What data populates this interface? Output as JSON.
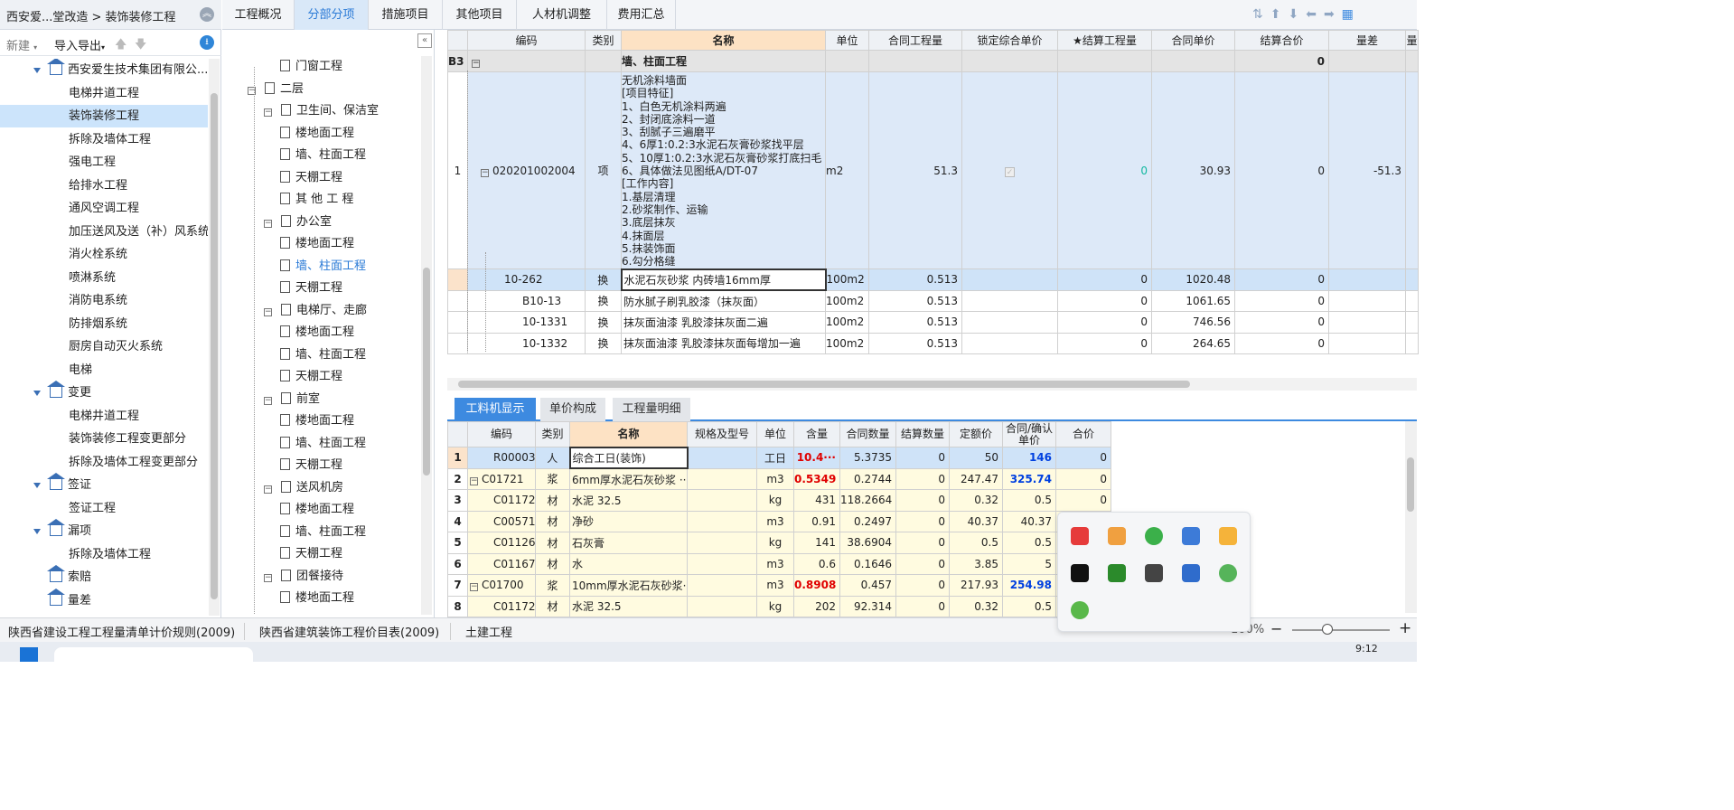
{
  "breadcrumb": "西安爱...堂改造 > 装饰装修工程",
  "left_toolbar": {
    "new": "新建",
    "import_export": "导入导出"
  },
  "left_tree": [
    {
      "label": "西安爱生技术集团有限公...",
      "type": "house",
      "expanded": true,
      "level": 1
    },
    {
      "label": "电梯井道工程",
      "level": 2
    },
    {
      "label": "装饰装修工程",
      "level": 2,
      "selected": true
    },
    {
      "label": "拆除及墙体工程",
      "level": 2
    },
    {
      "label": "强电工程",
      "level": 2
    },
    {
      "label": "给排水工程",
      "level": 2
    },
    {
      "label": "通风空调工程",
      "level": 2
    },
    {
      "label": "加压送风及送（补）风系统",
      "level": 2
    },
    {
      "label": "消火栓系统",
      "level": 2
    },
    {
      "label": "喷淋系统",
      "level": 2
    },
    {
      "label": "消防电系统",
      "level": 2
    },
    {
      "label": "防排烟系统",
      "level": 2
    },
    {
      "label": "厨房自动灭火系统",
      "level": 2
    },
    {
      "label": "电梯",
      "level": 2
    },
    {
      "label": "变更",
      "type": "house",
      "expanded": true,
      "level": 1
    },
    {
      "label": "电梯井道工程",
      "level": 2
    },
    {
      "label": "装饰装修工程变更部分",
      "level": 2
    },
    {
      "label": "拆除及墙体工程变更部分",
      "level": 2
    },
    {
      "label": "签证",
      "type": "house",
      "expanded": true,
      "level": 1
    },
    {
      "label": "签证工程",
      "level": 2
    },
    {
      "label": "漏项",
      "type": "house",
      "expanded": true,
      "level": 1
    },
    {
      "label": "拆除及墙体工程",
      "level": 2
    },
    {
      "label": "索赔",
      "type": "house",
      "level": 1
    },
    {
      "label": "量差",
      "type": "house",
      "level": 1
    }
  ],
  "mid_tree": [
    {
      "label": "门窗工程",
      "level": 3
    },
    {
      "label": "二层",
      "level": 1
    },
    {
      "label": "卫生间、保洁室",
      "level": 2
    },
    {
      "label": "楼地面工程",
      "level": 3
    },
    {
      "label": "墙、柱面工程",
      "level": 3
    },
    {
      "label": "天棚工程",
      "level": 3
    },
    {
      "label": "其 他 工 程",
      "level": 3
    },
    {
      "label": "办公室",
      "level": 2
    },
    {
      "label": "楼地面工程",
      "level": 3
    },
    {
      "label": "墙、柱面工程",
      "level": 3,
      "active": true
    },
    {
      "label": "天棚工程",
      "level": 3
    },
    {
      "label": "电梯厅、走廊",
      "level": 2
    },
    {
      "label": "楼地面工程",
      "level": 3
    },
    {
      "label": "墙、柱面工程",
      "level": 3
    },
    {
      "label": "天棚工程",
      "level": 3
    },
    {
      "label": "前室",
      "level": 2
    },
    {
      "label": "楼地面工程",
      "level": 3
    },
    {
      "label": "墙、柱面工程",
      "level": 3
    },
    {
      "label": "天棚工程",
      "level": 3
    },
    {
      "label": "送风机房",
      "level": 2
    },
    {
      "label": "楼地面工程",
      "level": 3
    },
    {
      "label": "墙、柱面工程",
      "level": 3
    },
    {
      "label": "天棚工程",
      "level": 3
    },
    {
      "label": "团餐接待",
      "level": 2
    },
    {
      "label": "楼地面工程",
      "level": 3
    }
  ],
  "tabs": [
    "工程概况",
    "分部分项",
    "措施项目",
    "其他项目",
    "人材机调整",
    "费用汇总"
  ],
  "top_headers": [
    "编码",
    "类别",
    "名称",
    "单位",
    "合同工程量",
    "锁定综合单价",
    "★结算工程量",
    "合同单价",
    "结算合价",
    "量差",
    "量"
  ],
  "group_row": {
    "code": "B3",
    "name": "墙、柱面工程",
    "amount": "0"
  },
  "item_row": {
    "no": "1",
    "code": "020201002004",
    "type": "项",
    "name_lines": [
      "无机涂料墙面",
      "[项目特征]",
      "1、白色无机涂料两遍",
      "2、封闭底涂料一道",
      "3、刮腻子三遍磨平",
      "4、6厚1:0.2:3水泥石灰膏砂浆找平层",
      "5、10厚1:0.2:3水泥石灰膏砂浆打底扫毛",
      "6、具体做法见图纸A/DT-07",
      "[工作内容]",
      "1.基层清理",
      "2.砂浆制作、运输",
      "3.底层抹灰",
      "4.抹面层",
      "5.抹装饰面",
      "6.勾分格缝"
    ],
    "unit": "m2",
    "qty": "51.3",
    "settle_qty": "0",
    "price": "30.93",
    "total": "0",
    "diff": "-51.3"
  },
  "sub_rows": [
    {
      "code": "10-262",
      "type": "换",
      "name": "水泥石灰砂浆 内砖墙16mm厚",
      "unit": "100m2",
      "qty": "0.513",
      "settle_qty": "0",
      "price": "1020.48",
      "total": "0"
    },
    {
      "code": "B10-13",
      "type": "换",
      "name": "防水腻子刷乳胶漆（抹灰面）",
      "unit": "100m2",
      "qty": "0.513",
      "settle_qty": "0",
      "price": "1061.65",
      "total": "0"
    },
    {
      "code": "10-1331",
      "type": "换",
      "name": "抹灰面油漆 乳胶漆抹灰面二遍",
      "unit": "100m2",
      "qty": "0.513",
      "settle_qty": "0",
      "price": "746.56",
      "total": "0"
    },
    {
      "code": "10-1332",
      "type": "换",
      "name": "抹灰面油漆 乳胶漆抹灰面每增加一遍",
      "unit": "100m2",
      "qty": "0.513",
      "settle_qty": "0",
      "price": "264.65",
      "total": "0"
    }
  ],
  "bottom_tabs": [
    "工料机显示",
    "单价构成",
    "工程量明细"
  ],
  "bottom_headers": [
    "编码",
    "类别",
    "名称",
    "规格及型号",
    "单位",
    "含量",
    "合同数量",
    "结算数量",
    "定额价",
    "合同/确认单价",
    "合价"
  ],
  "bottom_rows": [
    {
      "no": "1",
      "code": "R00003",
      "type": "人",
      "name": "综合工日(装饰)",
      "unit": "工日",
      "content": "10.4···",
      "contract_qty": "5.3735",
      "settle_qty": "0",
      "quota": "50",
      "price": "146",
      "total": "0",
      "sel": true
    },
    {
      "no": "2",
      "code": "C01721",
      "type": "浆",
      "name": "6mm厚水泥石灰砂浆 ···",
      "unit": "m3",
      "content": "0.5349",
      "contract_qty": "0.2744",
      "settle_qty": "0",
      "quota": "247.47",
      "price": "325.74",
      "total": "0",
      "group": true
    },
    {
      "no": "3",
      "code": "C01172",
      "type": "材",
      "name": "水泥 32.5",
      "unit": "kg",
      "content": "431",
      "contract_qty": "118.2664",
      "settle_qty": "0",
      "quota": "0.32",
      "price": "0.5",
      "total": "0"
    },
    {
      "no": "4",
      "code": "C00571",
      "type": "材",
      "name": "净砂",
      "unit": "m3",
      "content": "0.91",
      "contract_qty": "0.2497",
      "settle_qty": "0",
      "quota": "40.37",
      "price": "40.37",
      "total": ""
    },
    {
      "no": "5",
      "code": "C01126",
      "type": "材",
      "name": "石灰膏",
      "unit": "kg",
      "content": "141",
      "contract_qty": "38.6904",
      "settle_qty": "0",
      "quota": "0.5",
      "price": "0.5",
      "total": ""
    },
    {
      "no": "6",
      "code": "C01167",
      "type": "材",
      "name": "水",
      "unit": "m3",
      "content": "0.6",
      "contract_qty": "0.1646",
      "settle_qty": "0",
      "quota": "3.85",
      "price": "5",
      "total": ""
    },
    {
      "no": "7",
      "code": "C01700",
      "type": "浆",
      "name": "10mm厚水泥石灰砂浆···",
      "unit": "m3",
      "content": "0.8908",
      "contract_qty": "0.457",
      "settle_qty": "0",
      "quota": "217.93",
      "price": "254.98",
      "total": "",
      "group": true
    },
    {
      "no": "8",
      "code": "C01172",
      "type": "材",
      "name": "水泥 32.5",
      "unit": "kg",
      "content": "202",
      "contract_qty": "92.314",
      "settle_qty": "0",
      "quota": "0.32",
      "price": "0.5",
      "total": ""
    }
  ],
  "status_bar": [
    "陕西省建设工程工程量清单计价规则(2009)",
    "陕西省建筑装饰工程价目表(2009)",
    "土建工程"
  ],
  "zoom": "100%",
  "clock": "9:12"
}
